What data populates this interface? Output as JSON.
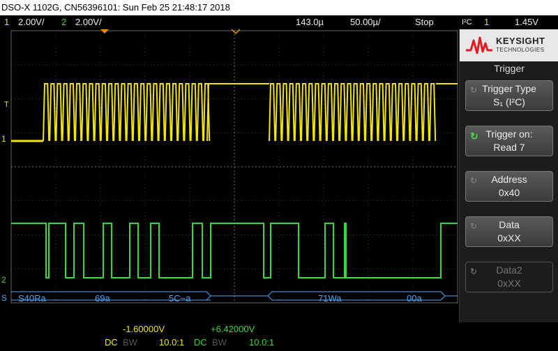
{
  "titlebar": {
    "text": "DSO-X 1102G, CN56396101: Sun Feb 25 21:48:17 2018"
  },
  "topbar": {
    "ch1_num": "1",
    "ch1_scale": "2.00V/",
    "ch2_num": "2",
    "ch2_scale": "2.00V/",
    "delay": "143.0µ",
    "timebase": "50.00µ/",
    "run_state": "Stop",
    "trig_type": "I²C",
    "trig_src": "1",
    "trig_level": "1.45V"
  },
  "plot": {
    "ch1_marker": "1",
    "ch2_marker": "2",
    "bus_marker": "S",
    "trig_marker": "T",
    "bus_segments": [
      "S40Ra",
      "69a",
      "5C~a",
      "71Wa",
      "00a"
    ]
  },
  "sidebar": {
    "brand": "KEYSIGHT",
    "brand_sub": "TECHNOLOGIES",
    "menu_title": "Trigger",
    "softkeys": [
      {
        "label": "Trigger Type",
        "value": "S₁ (I²C)"
      },
      {
        "label": "Trigger on:",
        "value": "Read 7"
      },
      {
        "label": "Address",
        "value": "0x40"
      },
      {
        "label": "Data",
        "value": "0xXX"
      },
      {
        "label": "Data2",
        "value": "0xXX"
      }
    ]
  },
  "bottom": {
    "ch1_offset": "-1.60000V",
    "ch2_offset": "+6.42000V",
    "ch1_coupling": "DC",
    "ch1_bw": "BW",
    "ch1_probe": "10.0:1",
    "ch2_coupling": "DC",
    "ch2_bw": "BW",
    "ch2_probe": "10.0:1"
  },
  "colors": {
    "ch1": "#f2e600",
    "ch2": "#33dd33",
    "bus": "#4aa8ff",
    "grid": "#555555",
    "trigger_marker": "#ff8a00"
  }
}
